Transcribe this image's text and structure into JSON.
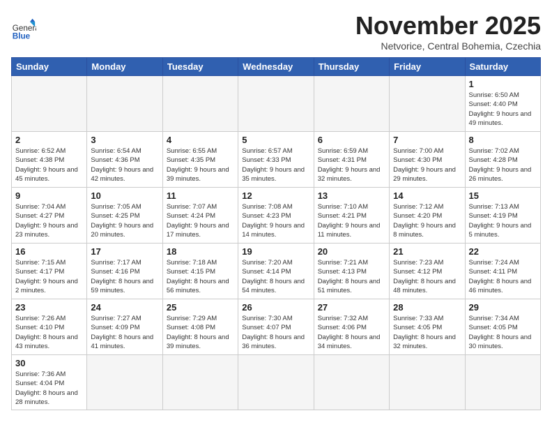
{
  "header": {
    "logo_general": "General",
    "logo_blue": "Blue",
    "month_title": "November 2025",
    "location": "Netvorice, Central Bohemia, Czechia"
  },
  "days_of_week": [
    "Sunday",
    "Monday",
    "Tuesday",
    "Wednesday",
    "Thursday",
    "Friday",
    "Saturday"
  ],
  "weeks": [
    [
      {
        "num": "",
        "info": ""
      },
      {
        "num": "",
        "info": ""
      },
      {
        "num": "",
        "info": ""
      },
      {
        "num": "",
        "info": ""
      },
      {
        "num": "",
        "info": ""
      },
      {
        "num": "",
        "info": ""
      },
      {
        "num": "1",
        "info": "Sunrise: 6:50 AM\nSunset: 4:40 PM\nDaylight: 9 hours and 49 minutes."
      }
    ],
    [
      {
        "num": "2",
        "info": "Sunrise: 6:52 AM\nSunset: 4:38 PM\nDaylight: 9 hours and 45 minutes."
      },
      {
        "num": "3",
        "info": "Sunrise: 6:54 AM\nSunset: 4:36 PM\nDaylight: 9 hours and 42 minutes."
      },
      {
        "num": "4",
        "info": "Sunrise: 6:55 AM\nSunset: 4:35 PM\nDaylight: 9 hours and 39 minutes."
      },
      {
        "num": "5",
        "info": "Sunrise: 6:57 AM\nSunset: 4:33 PM\nDaylight: 9 hours and 35 minutes."
      },
      {
        "num": "6",
        "info": "Sunrise: 6:59 AM\nSunset: 4:31 PM\nDaylight: 9 hours and 32 minutes."
      },
      {
        "num": "7",
        "info": "Sunrise: 7:00 AM\nSunset: 4:30 PM\nDaylight: 9 hours and 29 minutes."
      },
      {
        "num": "8",
        "info": "Sunrise: 7:02 AM\nSunset: 4:28 PM\nDaylight: 9 hours and 26 minutes."
      }
    ],
    [
      {
        "num": "9",
        "info": "Sunrise: 7:04 AM\nSunset: 4:27 PM\nDaylight: 9 hours and 23 minutes."
      },
      {
        "num": "10",
        "info": "Sunrise: 7:05 AM\nSunset: 4:25 PM\nDaylight: 9 hours and 20 minutes."
      },
      {
        "num": "11",
        "info": "Sunrise: 7:07 AM\nSunset: 4:24 PM\nDaylight: 9 hours and 17 minutes."
      },
      {
        "num": "12",
        "info": "Sunrise: 7:08 AM\nSunset: 4:23 PM\nDaylight: 9 hours and 14 minutes."
      },
      {
        "num": "13",
        "info": "Sunrise: 7:10 AM\nSunset: 4:21 PM\nDaylight: 9 hours and 11 minutes."
      },
      {
        "num": "14",
        "info": "Sunrise: 7:12 AM\nSunset: 4:20 PM\nDaylight: 9 hours and 8 minutes."
      },
      {
        "num": "15",
        "info": "Sunrise: 7:13 AM\nSunset: 4:19 PM\nDaylight: 9 hours and 5 minutes."
      }
    ],
    [
      {
        "num": "16",
        "info": "Sunrise: 7:15 AM\nSunset: 4:17 PM\nDaylight: 9 hours and 2 minutes."
      },
      {
        "num": "17",
        "info": "Sunrise: 7:17 AM\nSunset: 4:16 PM\nDaylight: 8 hours and 59 minutes."
      },
      {
        "num": "18",
        "info": "Sunrise: 7:18 AM\nSunset: 4:15 PM\nDaylight: 8 hours and 56 minutes."
      },
      {
        "num": "19",
        "info": "Sunrise: 7:20 AM\nSunset: 4:14 PM\nDaylight: 8 hours and 54 minutes."
      },
      {
        "num": "20",
        "info": "Sunrise: 7:21 AM\nSunset: 4:13 PM\nDaylight: 8 hours and 51 minutes."
      },
      {
        "num": "21",
        "info": "Sunrise: 7:23 AM\nSunset: 4:12 PM\nDaylight: 8 hours and 48 minutes."
      },
      {
        "num": "22",
        "info": "Sunrise: 7:24 AM\nSunset: 4:11 PM\nDaylight: 8 hours and 46 minutes."
      }
    ],
    [
      {
        "num": "23",
        "info": "Sunrise: 7:26 AM\nSunset: 4:10 PM\nDaylight: 8 hours and 43 minutes."
      },
      {
        "num": "24",
        "info": "Sunrise: 7:27 AM\nSunset: 4:09 PM\nDaylight: 8 hours and 41 minutes."
      },
      {
        "num": "25",
        "info": "Sunrise: 7:29 AM\nSunset: 4:08 PM\nDaylight: 8 hours and 39 minutes."
      },
      {
        "num": "26",
        "info": "Sunrise: 7:30 AM\nSunset: 4:07 PM\nDaylight: 8 hours and 36 minutes."
      },
      {
        "num": "27",
        "info": "Sunrise: 7:32 AM\nSunset: 4:06 PM\nDaylight: 8 hours and 34 minutes."
      },
      {
        "num": "28",
        "info": "Sunrise: 7:33 AM\nSunset: 4:05 PM\nDaylight: 8 hours and 32 minutes."
      },
      {
        "num": "29",
        "info": "Sunrise: 7:34 AM\nSunset: 4:05 PM\nDaylight: 8 hours and 30 minutes."
      }
    ],
    [
      {
        "num": "30",
        "info": "Sunrise: 7:36 AM\nSunset: 4:04 PM\nDaylight: 8 hours and 28 minutes."
      },
      {
        "num": "",
        "info": ""
      },
      {
        "num": "",
        "info": ""
      },
      {
        "num": "",
        "info": ""
      },
      {
        "num": "",
        "info": ""
      },
      {
        "num": "",
        "info": ""
      },
      {
        "num": "",
        "info": ""
      }
    ]
  ]
}
